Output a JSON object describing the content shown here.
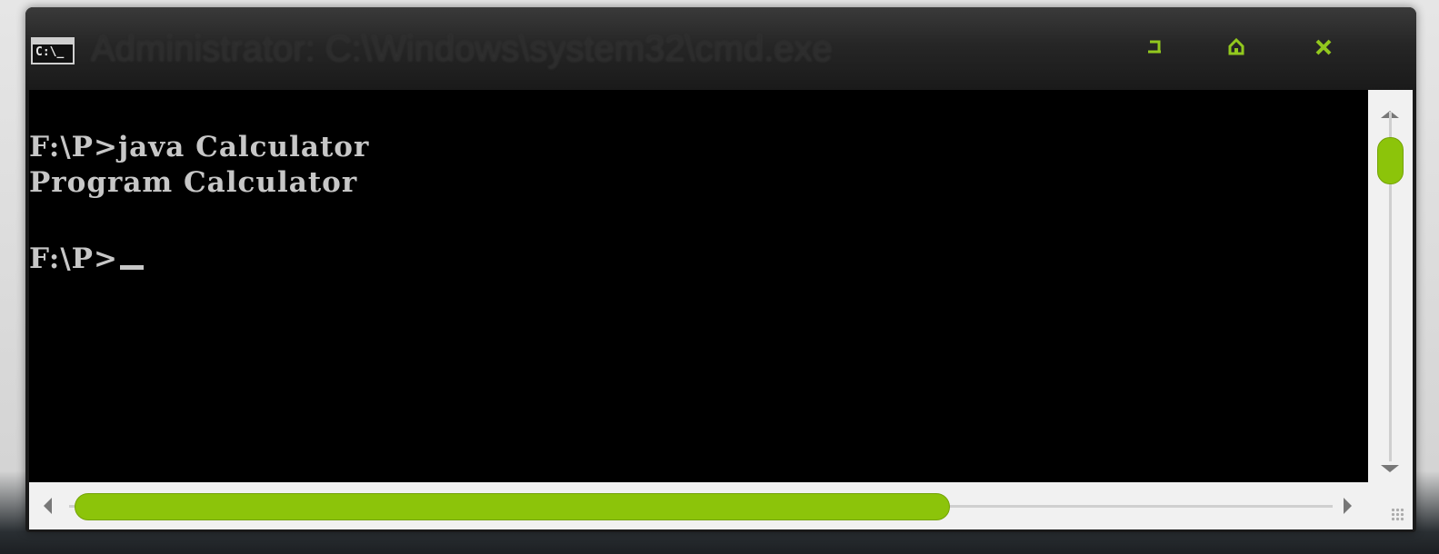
{
  "window": {
    "title": "Administrator: C:\\Windows\\system32\\cmd.exe",
    "icon": "cmd-icon",
    "icon_text": "C:\\_",
    "buttons": [
      {
        "name": "minimize",
        "icon": "minimize-icon"
      },
      {
        "name": "maximize",
        "icon": "maximize-icon"
      },
      {
        "name": "close",
        "icon": "close-icon"
      }
    ],
    "accent_color": "#8cc40a"
  },
  "console": {
    "lines": [
      "F:\\P>java Calculator",
      "Program Calculator",
      "F:\\P>"
    ],
    "text_color": "#c7c7c7",
    "background": "#000000"
  },
  "scrollbars": {
    "vertical": {
      "up_icon": "arrow-up-icon",
      "down_icon": "arrow-down-icon"
    },
    "horizontal": {
      "left_icon": "arrow-left-icon",
      "right_icon": "arrow-right-icon"
    }
  }
}
